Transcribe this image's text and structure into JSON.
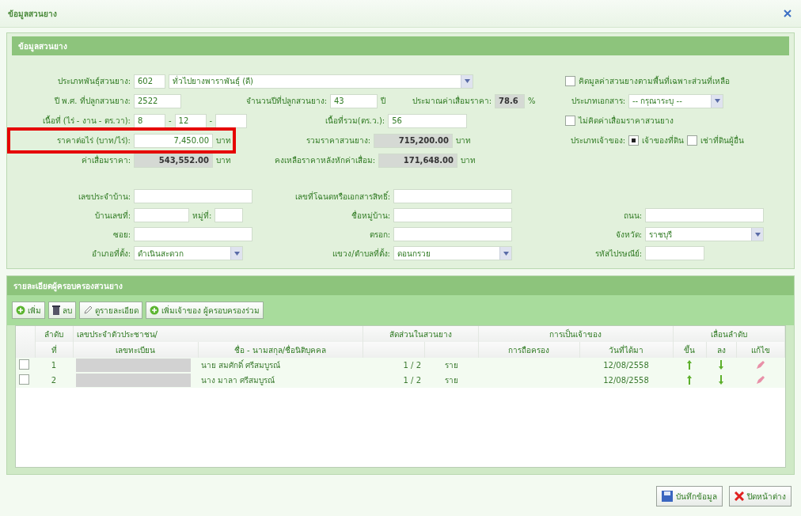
{
  "window": {
    "title": "ข้อมูลสวนยาง"
  },
  "plantation": {
    "header": "ข้อมูลสวนยาง",
    "type_label": "ประเภทพันธุ์สวนยาง:",
    "type_code": "602",
    "type_name": "ทั่วไปยางพาราพันธุ์ (ดี)",
    "year_label": "ปี พ.ศ. ที่ปลูกสวนยาง:",
    "year": "2522",
    "age_label": "จำนวนปีที่ปลูกสวนยาง:",
    "age": "43",
    "age_unit": "ปี",
    "dep_label": "ประมาณค่าเสื่อมราคา:",
    "dep": "78.6",
    "dep_unit": "%",
    "area_label": "เนื้อที่ (ไร่ - งาน - ตร.วา):",
    "rai": "8",
    "ngan": "12",
    "area_sep": "-",
    "total_area_label": "เนื้อที่รวม(ตร.ว.):",
    "total_area": "56",
    "price_label": "ราคาต่อไร่ (บาท/ไร่):",
    "price": "7,450.00",
    "price_unit": "บาท",
    "price_highlighted": true,
    "sum_label": "รวมราคาสวนยาง:",
    "sum": "715,200.00",
    "sum_unit": "บาท",
    "depval_label": "ค่าเสื่อมราคา:",
    "depval": "543,552.00",
    "depval_unit": "บาท",
    "remain_label": "คงเหลือราคาหลังหักค่าเสื่อม:",
    "remain": "171,648.00",
    "remain_unit": "บาท"
  },
  "options": {
    "partial_label": "คิดมูลค่าสวนยางตามพื้นที่เฉพาะส่วนที่เหลือ",
    "partial_checked": false,
    "doc_label": "ประเภทเอกสาร:",
    "doc_value": "-- กรุณาระบุ --",
    "nodep_label": "ไม่คิดค่าเสื่อมราคาสวนยาง",
    "nodep_checked": false,
    "owner_label": "ประเภทเจ้าของ:",
    "owner_options": [
      {
        "label": "เจ้าของที่ดิน",
        "selected": true
      },
      {
        "label": "เช่าที่ดินผู้อื่น",
        "selected": false
      }
    ]
  },
  "address": {
    "house_id_label": "เลขประจำบ้าน:",
    "deed_label": "เลขที่โฉนดหรือเอกสารสิทธิ์:",
    "house_no_label": "บ้านเลขที่:",
    "moo_label": "หมู่ที่:",
    "village_label": "ชื่อหมู่บ้าน:",
    "road_label": "ถนน:",
    "soi_label": "ซอย:",
    "lane_label": "ตรอก:",
    "district_label": "อำเภอที่ตั้ง:",
    "district_value": "ดำเนินสะดวก",
    "area_label": "แขวง/ตำบลที่ตั้ง:",
    "area_value": "ดอนกรวย",
    "province_label": "จังหวัด:",
    "province_value": "ราชบุรี",
    "postcode_label": "รหัสไปรษณีย์:"
  },
  "owners": {
    "header": "รายละเอียดผู้ครอบครองสวนยาง",
    "buttons": [
      {
        "kind": "add",
        "label": "เพิ่ม"
      },
      {
        "kind": "delete",
        "label": "ลบ"
      },
      {
        "kind": "edit",
        "label": "ดูรายละเอียด"
      },
      {
        "kind": "add",
        "label": "เพิ่มเจ้าของ ผู้ครอบครองร่วม"
      }
    ],
    "head1": [
      "ลำดับ",
      "เลขประจำตัวประชาชน/",
      "สัดส่วนในสวนยาง",
      "การเป็นเจ้าของ",
      "เลื่อนลำดับ"
    ],
    "head2": [
      "ที่",
      "เลขทะเบียน",
      "ชื่อ - นามสกุล/ชื่อนิติบุคคล",
      "การถือครอง",
      "วันที่ได้มา",
      "ขึ้น",
      "ลง",
      "แก้ไข"
    ],
    "rows": [
      {
        "checked": false,
        "no": "1",
        "id_hidden": true,
        "name": "นาย สมศักดิ์ ศรีสมบูรณ์",
        "share": "1 / 2",
        "unit": "ราย",
        "date": "12/08/2558"
      },
      {
        "checked": false,
        "no": "2",
        "id_hidden": true,
        "name": "นาง มาลา ศรีสมบูรณ์",
        "share": "1 / 2",
        "unit": "ราย",
        "date": "12/08/2558"
      }
    ]
  },
  "footer": {
    "save": "บันทึกข้อมูล",
    "close": "ปิดหน้าต่าง"
  }
}
